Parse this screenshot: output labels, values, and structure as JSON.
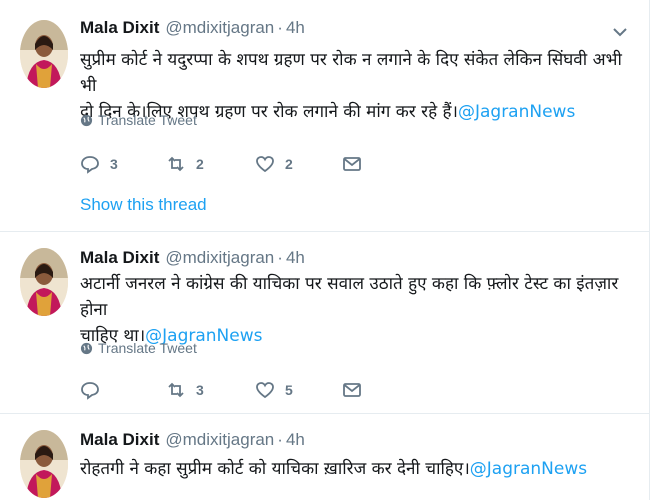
{
  "tweets": [
    {
      "name": "Mala Dixit",
      "handle": "@mdixitjagran",
      "separator": "·",
      "time": "4h",
      "text_line1": "सुप्रीम कोर्ट ने यदुरप्पा के शपथ ग्रहण पर रोक न लगाने के दिए संकेत लेकिन सिंघवी अभी भी",
      "text_line2": "दो दिन के।लिए शपथ ग्रहण पर रोक लगाने की मांग कर रहे हैं।",
      "mention": "@JagranNews",
      "translate_label": "Translate Tweet",
      "reply_count": "3",
      "retweet_count": "2",
      "like_count": "2",
      "thread_label": "Show this thread"
    },
    {
      "name": "Mala Dixit",
      "handle": "@mdixitjagran",
      "separator": "·",
      "time": "4h",
      "text_line1": "अटार्नी जनरल ने कांग्रेस की याचिका पर सवाल उठाते हुए कहा कि फ़्लोर टेस्ट का इंतज़ार होना",
      "text_line2": "चाहिए था।",
      "mention": "@JagranNews",
      "translate_label": "Translate Tweet",
      "reply_count": "",
      "retweet_count": "3",
      "like_count": "5"
    },
    {
      "name": "Mala Dixit",
      "handle": "@mdixitjagran",
      "separator": "·",
      "time": "4h",
      "text_line1": "रोहतगी ने कहा सुप्रीम कोर्ट को याचिका ख़ारिज कर देनी चाहिए।",
      "mention": "@JagranNews"
    }
  ],
  "colors": {
    "accent": "#1da1f2",
    "muted": "#657786",
    "text": "#14171a",
    "divider": "#e6ecf0"
  },
  "icons": [
    "avatar",
    "chevron-down-icon",
    "globe-icon",
    "reply-icon",
    "retweet-icon",
    "like-icon",
    "message-icon"
  ]
}
